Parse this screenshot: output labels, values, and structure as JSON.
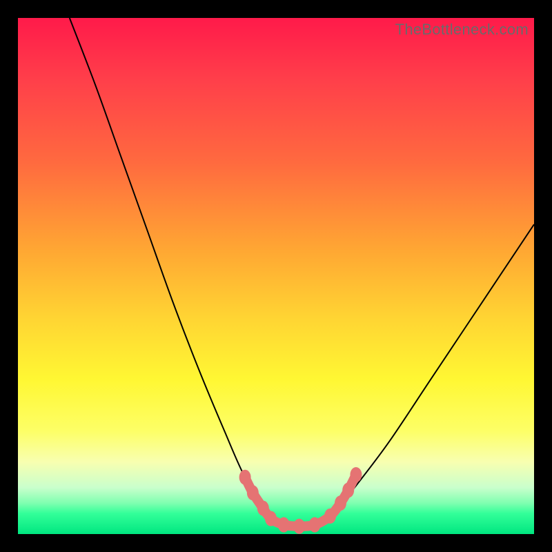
{
  "watermark": "TheBottleneck.com",
  "chart_data": {
    "type": "line",
    "title": "",
    "xlabel": "",
    "ylabel": "",
    "xlim": [
      0,
      100
    ],
    "ylim": [
      0,
      100
    ],
    "grid": false,
    "legend": false,
    "note": "Bottleneck-style curve. Axes unlabeled; values estimated from pixel positions on a 0–100 scale. y ≈ 0 at trough (x ≈ 50–60), rising steeply on both sides.",
    "series": [
      {
        "name": "bottleneck-curve",
        "x": [
          10,
          15,
          20,
          25,
          30,
          35,
          40,
          44,
          48,
          50,
          52,
          54,
          56,
          58,
          60,
          62,
          66,
          72,
          80,
          90,
          100
        ],
        "y": [
          100,
          87,
          73,
          59,
          45,
          32,
          20,
          11,
          5,
          3,
          2,
          1.5,
          1.5,
          2,
          3,
          5,
          10,
          18,
          30,
          45,
          60
        ]
      }
    ],
    "markers": [
      {
        "name": "bead-left-1",
        "x": 44.0,
        "y": 11.0
      },
      {
        "name": "bead-left-2",
        "x": 45.5,
        "y": 8.0
      },
      {
        "name": "bead-left-3",
        "x": 47.5,
        "y": 5.0
      },
      {
        "name": "bead-left-4",
        "x": 49.0,
        "y": 3.0
      },
      {
        "name": "bead-trough-1",
        "x": 51.5,
        "y": 1.8
      },
      {
        "name": "bead-trough-2",
        "x": 54.5,
        "y": 1.5
      },
      {
        "name": "bead-trough-3",
        "x": 57.5,
        "y": 1.8
      },
      {
        "name": "bead-right-1",
        "x": 60.5,
        "y": 3.5
      },
      {
        "name": "bead-right-2",
        "x": 62.5,
        "y": 6.0
      },
      {
        "name": "bead-right-3",
        "x": 64.0,
        "y": 8.5
      },
      {
        "name": "bead-right-4",
        "x": 65.5,
        "y": 11.5
      }
    ],
    "colors": {
      "curve": "#000000",
      "beads": "#e57373",
      "gradient_top": "#ff1a4a",
      "gradient_mid": "#fff733",
      "gradient_bottom": "#00e680"
    }
  }
}
